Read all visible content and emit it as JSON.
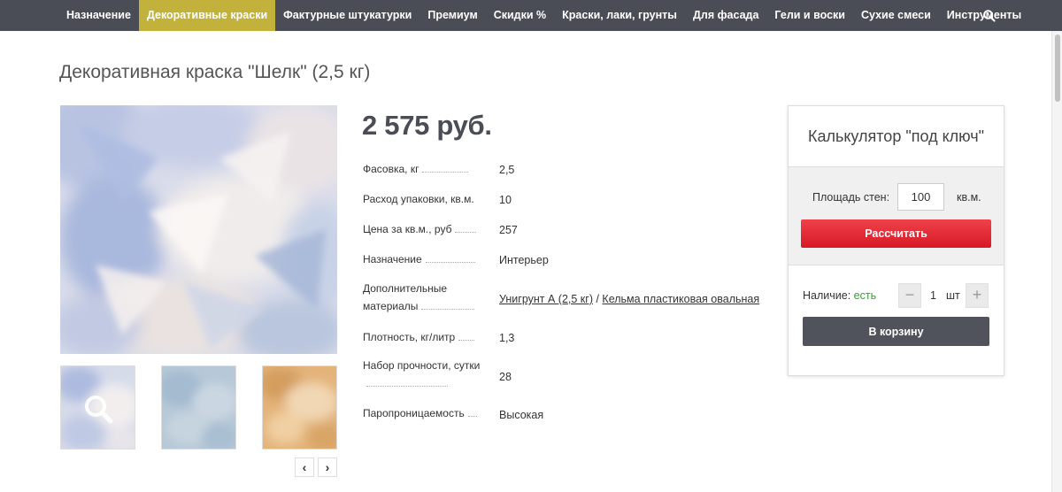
{
  "nav": {
    "items": [
      {
        "label": "Назначение"
      },
      {
        "label": "Декоративные краски"
      },
      {
        "label": "Фактурные штукатурки"
      },
      {
        "label": "Премиум"
      },
      {
        "label": "Скидки %"
      },
      {
        "label": "Краски, лаки, грунты"
      },
      {
        "label": "Для фасада"
      },
      {
        "label": "Гели и воски"
      },
      {
        "label": "Сухие смеси"
      },
      {
        "label": "Инструменты"
      }
    ],
    "active_index": 1,
    "search_icon": "search-icon",
    "active_color": "#c2b23c",
    "bar_color": "#4a4d55"
  },
  "product": {
    "title": "Декоративная краска \"Шелк\" (2,5 кг)",
    "price": "2 575 руб.",
    "thumbnails": [
      "silk-blue-white",
      "silk-pale-blue",
      "silk-ochre"
    ],
    "thumb_zoom_icon": "magnifier-icon",
    "prev_arrow": "‹",
    "next_arrow": "›"
  },
  "specs": [
    {
      "label": "Фасовка, кг",
      "value": "2,5"
    },
    {
      "label": "Расход упаковки, кв.м.",
      "value": "10"
    },
    {
      "label": "Цена за кв.м., руб",
      "value": "257"
    },
    {
      "label": "Назначение",
      "value": "Интерьер"
    },
    {
      "label": "Дополнительные материалы",
      "value_links": [
        "Унигрунт А (2,5 кг)",
        "Кельма пластиковая овальная"
      ],
      "separator": " / "
    },
    {
      "label": "Плотность, кг/литр",
      "value": "1,3"
    },
    {
      "label": "Набор прочности, сутки",
      "value": "28"
    },
    {
      "label": "Паропроницаемость",
      "value": "Высокая"
    }
  ],
  "calculator": {
    "title": "Калькулятор \"под ключ\"",
    "area_label": "Площадь стен:",
    "area_value": "100",
    "area_unit": "кв.м.",
    "calc_button": "Рассчитать",
    "availability_label": "Наличие:",
    "availability_value": "есть",
    "qty_minus": "−",
    "qty_value": "1",
    "qty_unit": "шт",
    "qty_plus": "+",
    "cart_button": "В корзину",
    "accent_color": "#e3222d"
  }
}
